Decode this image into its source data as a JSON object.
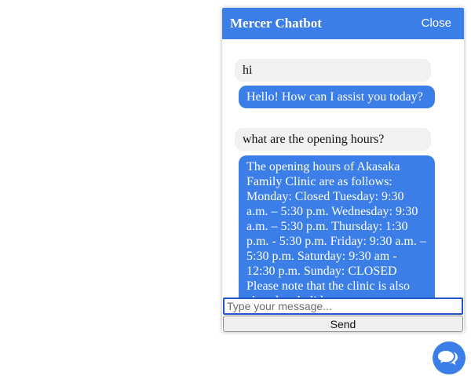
{
  "chat": {
    "title": "Mercer Chatbot",
    "close_label": "Close",
    "messages": [
      {
        "sender": "user",
        "text": "hi"
      },
      {
        "sender": "bot",
        "text": "Hello! How can I assist you today?"
      },
      {
        "sender": "user",
        "text": "what are the opening hours?"
      },
      {
        "sender": "bot",
        "text": "The opening hours of Akasaka Family Clinic are as follows: Monday: Closed Tuesday: 9:30 a.m. – 5:30 p.m. Wednesday: 9:30 a.m. – 5:30 p.m. Thursday: 1:30 p.m. - 5:30 p.m. Friday: 9:30 a.m. – 5:30 p.m. Saturday: 9:30 am - 12:30 p.m. Sunday: CLOSED Please note that the clinic is also closed on holidays."
      }
    ],
    "input": {
      "placeholder": "Type your message...",
      "value": ""
    },
    "send_label": "Send"
  },
  "launcher": {
    "icon": "chat-bubbles-icon"
  },
  "colors": {
    "accent": "#3b7ee8",
    "user_bubble": "#f1f1f1",
    "input_border": "#1f56c8"
  }
}
